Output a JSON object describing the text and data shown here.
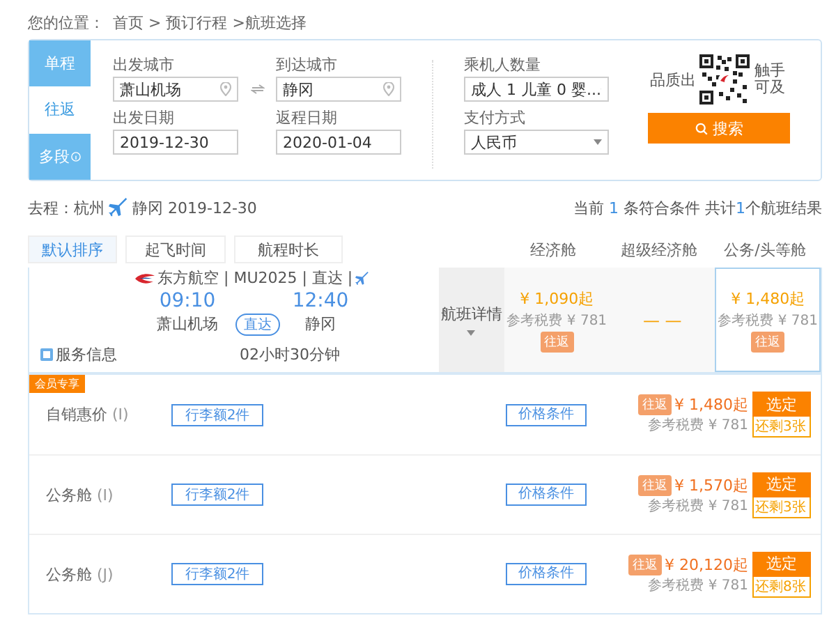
{
  "breadcrumb": {
    "label": "您的位置：",
    "path": "首页 > 预订行程 >航班选择"
  },
  "trip_tabs": [
    {
      "label": "单程",
      "selected": false
    },
    {
      "label": "往返",
      "selected": true
    },
    {
      "label": "多段",
      "selected": false
    }
  ],
  "form": {
    "from": {
      "label": "出发城市",
      "value": "萧山机场"
    },
    "to": {
      "label": "到达城市",
      "value": "静冈"
    },
    "depart_date": {
      "label": "出发日期",
      "value": "2019-12-30"
    },
    "return_date": {
      "label": "返程日期",
      "value": "2020-01-04"
    },
    "passengers": {
      "label": "乘机人数量",
      "value": "成人 1  儿童 0  婴..."
    },
    "payment": {
      "label": "支付方式",
      "value": "人民币"
    }
  },
  "promo": {
    "left": "品质出",
    "right": "触手可及"
  },
  "search_button": "搜索",
  "route": {
    "prefix": "去程：",
    "from": "杭州",
    "to": "静冈",
    "date": "2019-12-30"
  },
  "summary": {
    "before": "当前 ",
    "count": "1",
    "middle": " 条符合条件 共计",
    "total": "1",
    "after": "个航班结果"
  },
  "sort_tabs": [
    {
      "label": "默认排序",
      "selected": true
    },
    {
      "label": "起飞时间",
      "selected": false
    },
    {
      "label": "航程时长",
      "selected": false
    }
  ],
  "cabin_headers": [
    "经济舱",
    "超级经济舱",
    "公务/头等舱"
  ],
  "flight": {
    "airline": "东方航空 | MU2025 | 直达 |",
    "depart_time": "09:10",
    "arrive_time": "12:40",
    "depart_airport": "萧山机场",
    "arrive_airport": "静冈",
    "stop": "直达",
    "duration": "02小时30分钟",
    "service": "服务信息",
    "details": "航班详情",
    "fares": [
      {
        "kind": "price",
        "price": "¥ 1,090起",
        "tax": "参考税费 ¥ 781",
        "badge": "往返",
        "selected": false
      },
      {
        "kind": "none",
        "text": "— —",
        "selected": false
      },
      {
        "kind": "price",
        "price": "¥ 1,480起",
        "tax": "参考税费 ¥ 781",
        "badge": "往返",
        "selected": true
      }
    ]
  },
  "member_tag": "会员专享",
  "fare_rows": [
    {
      "name": "自销惠价",
      "code": "(I)",
      "baggage": "行李额2件",
      "conditions": "价格条件",
      "badge": "往返",
      "price": "¥ 1,480起",
      "tax": "参考税费 ¥ 781",
      "button": "选定",
      "remaining": "还剩3张"
    },
    {
      "name": "公务舱",
      "code": "(I)",
      "baggage": "行李额2件",
      "conditions": "价格条件",
      "badge": "往返",
      "price": "¥ 1,570起",
      "tax": "参考税费 ¥ 781",
      "button": "选定",
      "remaining": "还剩3张"
    },
    {
      "name": "公务舱",
      "code": "(J)",
      "baggage": "行李额2件",
      "conditions": "价格条件",
      "badge": "往返",
      "price": "¥ 20,120起",
      "tax": "参考税费 ¥ 781",
      "button": "选定",
      "remaining": "还剩8张"
    }
  ]
}
